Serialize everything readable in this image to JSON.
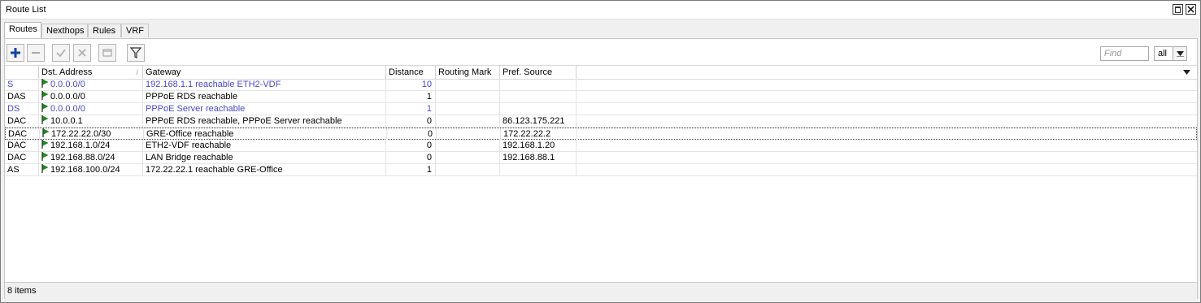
{
  "window": {
    "title": "Route List"
  },
  "tabs": [
    {
      "label": "Routes",
      "active": true
    },
    {
      "label": "Nexthops",
      "active": false
    },
    {
      "label": "Rules",
      "active": false
    },
    {
      "label": "VRF",
      "active": false
    }
  ],
  "toolbar": {
    "buttons": [
      "add-icon",
      "remove-icon",
      "enable-icon",
      "disable-icon",
      "comment-icon",
      "filter-icon"
    ],
    "find_placeholder": "Find",
    "filter_value": "all"
  },
  "table": {
    "columns": [
      "",
      "Dst. Address",
      "Gateway",
      "Distance",
      "Routing Mark",
      "Pref. Source"
    ],
    "rows": [
      {
        "flags": "S",
        "dst": "0.0.0.0/0",
        "gateway": "192.168.1.1 reachable ETH2-VDF",
        "distance": "10",
        "mark": "",
        "pref": "",
        "blue": true
      },
      {
        "flags": "DAS",
        "dst": "0.0.0.0/0",
        "gateway": "PPPoE RDS reachable",
        "distance": "1",
        "mark": "",
        "pref": "",
        "blue": false
      },
      {
        "flags": "DS",
        "dst": "0.0.0.0/0",
        "gateway": "PPPoE Server reachable",
        "distance": "1",
        "mark": "",
        "pref": "",
        "blue": true
      },
      {
        "flags": "DAC",
        "dst": "10.0.0.1",
        "gateway": "PPPoE RDS reachable, PPPoE Server reachable",
        "distance": "0",
        "mark": "",
        "pref": "86.123.175.221",
        "blue": false
      },
      {
        "flags": "DAC",
        "dst": "172.22.22.0/30",
        "gateway": "GRE-Office reachable",
        "distance": "0",
        "mark": "",
        "pref": "172.22.22.2",
        "blue": false,
        "focused": true
      },
      {
        "flags": "DAC",
        "dst": "192.168.1.0/24",
        "gateway": "ETH2-VDF reachable",
        "distance": "0",
        "mark": "",
        "pref": "192.168.1.20",
        "blue": false
      },
      {
        "flags": "DAC",
        "dst": "192.168.88.0/24",
        "gateway": "LAN Bridge reachable",
        "distance": "0",
        "mark": "",
        "pref": "192.168.88.1",
        "blue": false
      },
      {
        "flags": "AS",
        "dst": "192.168.100.0/24",
        "gateway": "172.22.22.1 reachable GRE-Office",
        "distance": "1",
        "mark": "",
        "pref": "",
        "blue": false
      }
    ]
  },
  "status": {
    "count": "8 items"
  },
  "colors": {
    "inactive_route": "#4747c8",
    "flag_green": "#1f8a1f",
    "toolbar_blue": "#1a3faa"
  }
}
